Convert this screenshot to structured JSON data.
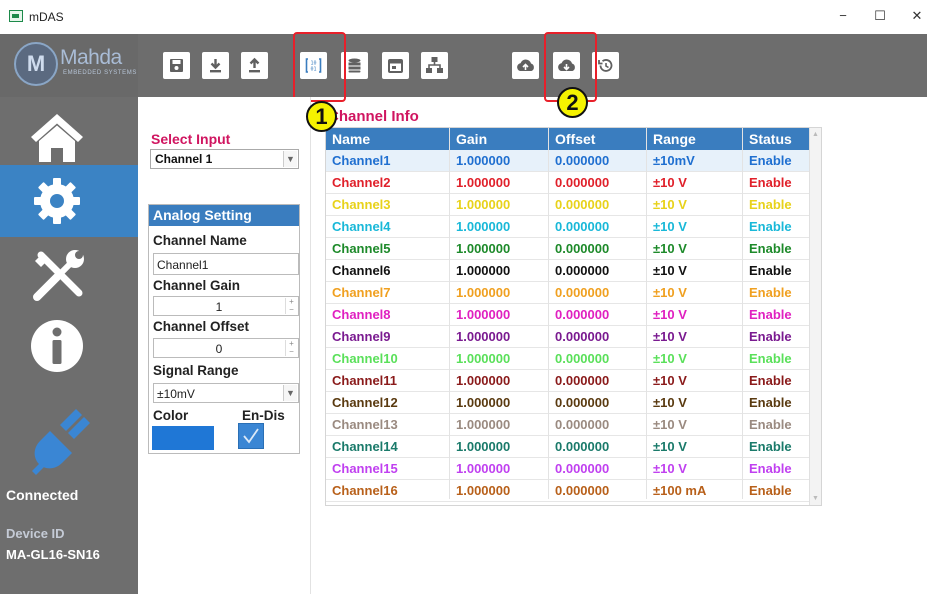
{
  "window": {
    "title": "mDAS",
    "minimize": "−",
    "maximize": "☐",
    "close": "✕"
  },
  "logo": {
    "initial": "M",
    "name": "Mahda",
    "subtitle": "EMBEDDED SYSTEMS"
  },
  "toolbar": {
    "buttons": [
      "save-icon",
      "download-icon",
      "upload-icon",
      "channel-info-icon",
      "database-icon",
      "calendar-icon",
      "network-icon",
      "cloud-upload-icon",
      "cloud-download-icon",
      "history-icon"
    ],
    "highlight_color": "#e8202a",
    "callouts": [
      "1",
      "2"
    ]
  },
  "sidebar": {
    "items": [
      "home-icon",
      "settings-icon",
      "tools-icon",
      "info-icon",
      "plug-icon"
    ],
    "active": "settings-icon",
    "status": "Connected",
    "device_id_label": "Device ID",
    "device_id": "MA-GL16-SN16"
  },
  "input": {
    "label": "Select Input",
    "selected": "Channel 1"
  },
  "analog": {
    "title": "Analog Setting",
    "channel_name_label": "Channel Name",
    "channel_name": "Channel1",
    "gain_label": "Channel Gain",
    "gain": "1",
    "offset_label": "Channel Offset",
    "offset": "0",
    "range_label": "Signal Range",
    "range": "±10mV",
    "color_label": "Color",
    "color": "#1f77d6",
    "endis_label": "En-Dis",
    "enabled": true
  },
  "table": {
    "title": "Channel Info",
    "headers": [
      "Name",
      "Gain",
      "Offset",
      "Range",
      "Status"
    ],
    "header_color": "#3a7dbf",
    "rows": [
      {
        "name": "Channel1",
        "gain": "1.000000",
        "offset": "0.000000",
        "range": "±10mV",
        "status": "Enable",
        "color": "#1f6fd0"
      },
      {
        "name": "Channel2",
        "gain": "1.000000",
        "offset": "0.000000",
        "range": "±10 V",
        "status": "Enable",
        "color": "#e0202a"
      },
      {
        "name": "Channel3",
        "gain": "1.000000",
        "offset": "0.000000",
        "range": "±10 V",
        "status": "Enable",
        "color": "#e8d21a"
      },
      {
        "name": "Channel4",
        "gain": "1.000000",
        "offset": "0.000000",
        "range": "±10 V",
        "status": "Enable",
        "color": "#19b8d8"
      },
      {
        "name": "Channel5",
        "gain": "1.000000",
        "offset": "0.000000",
        "range": "±10 V",
        "status": "Enable",
        "color": "#1d8a2a"
      },
      {
        "name": "Channel6",
        "gain": "1.000000",
        "offset": "0.000000",
        "range": "±10 V",
        "status": "Enable",
        "color": "#111111"
      },
      {
        "name": "Channel7",
        "gain": "1.000000",
        "offset": "0.000000",
        "range": "±10 V",
        "status": "Enable",
        "color": "#f0a020"
      },
      {
        "name": "Channel8",
        "gain": "1.000000",
        "offset": "0.000000",
        "range": "±10 V",
        "status": "Enable",
        "color": "#e020c0"
      },
      {
        "name": "Channel9",
        "gain": "1.000000",
        "offset": "0.000000",
        "range": "±10 V",
        "status": "Enable",
        "color": "#7a1a90"
      },
      {
        "name": "Channel10",
        "gain": "1.000000",
        "offset": "0.000000",
        "range": "±10 V",
        "status": "Enable",
        "color": "#5ae05a"
      },
      {
        "name": "Channel11",
        "gain": "1.000000",
        "offset": "0.000000",
        "range": "±10 V",
        "status": "Enable",
        "color": "#8a1a1a"
      },
      {
        "name": "Channel12",
        "gain": "1.000000",
        "offset": "0.000000",
        "range": "±10 V",
        "status": "Enable",
        "color": "#5a3a10"
      },
      {
        "name": "Channel13",
        "gain": "1.000000",
        "offset": "0.000000",
        "range": "±10 V",
        "status": "Enable",
        "color": "#9a8a80"
      },
      {
        "name": "Channel14",
        "gain": "1.000000",
        "offset": "0.000000",
        "range": "±10 V",
        "status": "Enable",
        "color": "#1a7a6a"
      },
      {
        "name": "Channel15",
        "gain": "1.000000",
        "offset": "0.000000",
        "range": "±10 V",
        "status": "Enable",
        "color": "#c040f0"
      },
      {
        "name": "Channel16",
        "gain": "1.000000",
        "offset": "0.000000",
        "range": "±100 mA",
        "status": "Enable",
        "color": "#b8601a"
      }
    ]
  }
}
